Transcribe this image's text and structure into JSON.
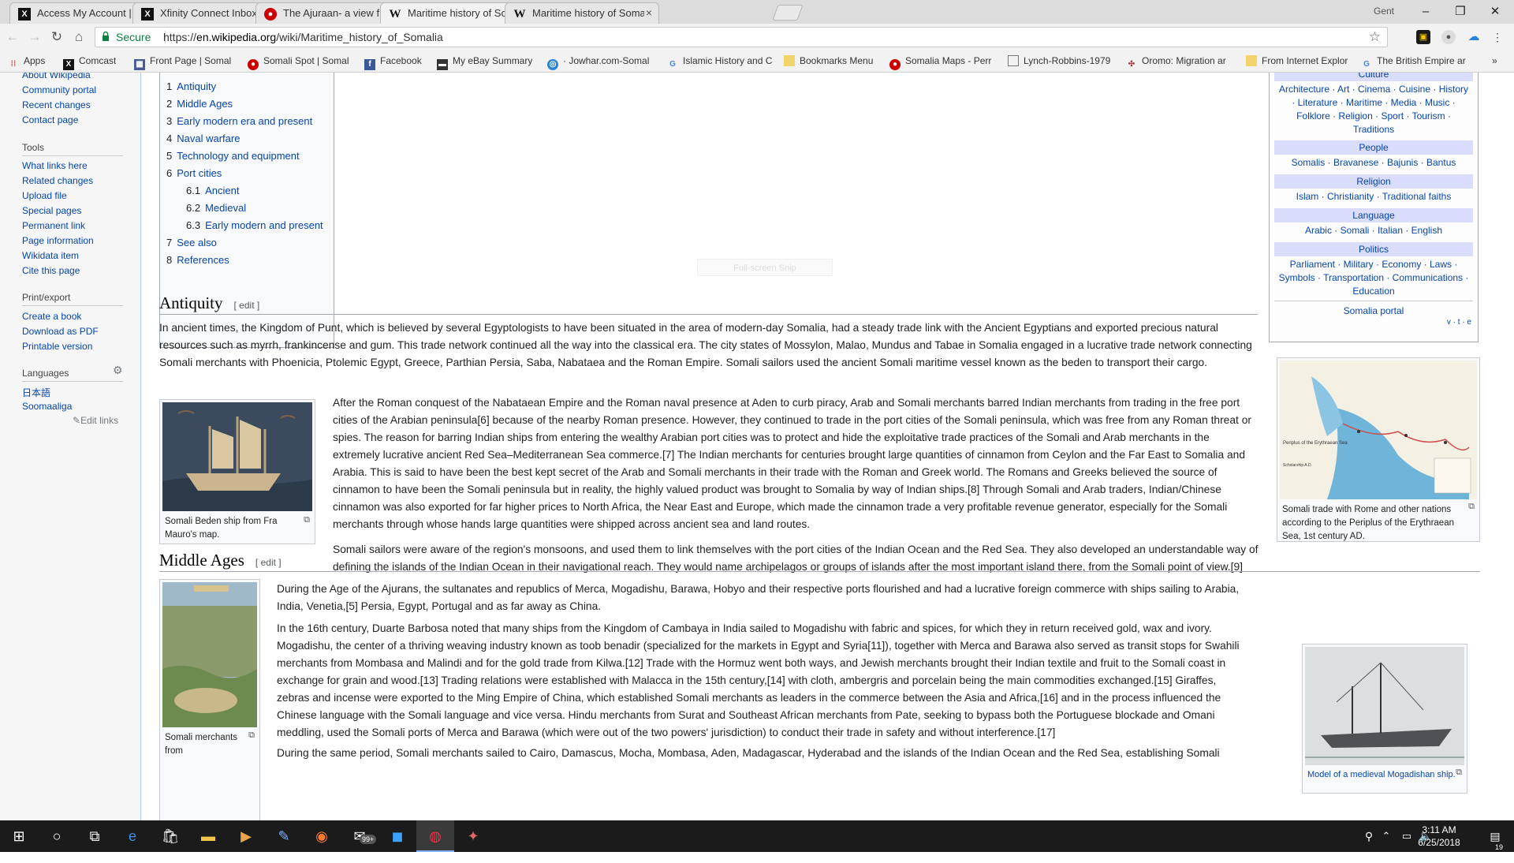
{
  "browser": {
    "tabs": [
      {
        "title": "Access My Account | Ema",
        "icon": "x-icon"
      },
      {
        "title": "Xfinity Connect Inbox",
        "icon": "x-icon"
      },
      {
        "title": "The Ajuraan- a view from",
        "icon": "pin-icon"
      },
      {
        "title": "Maritime history of Soma",
        "icon": "wikipedia-icon"
      },
      {
        "title": "Maritime history of Soma",
        "icon": "wikipedia-icon"
      }
    ],
    "user": "Gent",
    "secure_label": "Secure",
    "url_scheme": "https://",
    "url_host": "en.wikipedia.org",
    "url_path": "/wiki/Maritime_history_of_Somalia",
    "bookmarks": [
      "Apps",
      "Comcast",
      "Front Page | Somal",
      "Somali Spot | Somal",
      "Facebook",
      "My eBay Summary",
      "· Jowhar.com-Somal",
      "Islamic History and C",
      "Bookmarks Menu",
      "Somalia Maps - Perr",
      "Lynch-Robbins-1979",
      "Oromo: Migration ar",
      "From Internet Explor",
      "The British Empire ar"
    ],
    "more_bookmarks": "»"
  },
  "sidebar": {
    "top_links": [
      "About Wikipedia",
      "Community portal",
      "Recent changes",
      "Contact page"
    ],
    "tools_heading": "Tools",
    "tools": [
      "What links here",
      "Related changes",
      "Upload file",
      "Special pages",
      "Permanent link",
      "Page information",
      "Wikidata item",
      "Cite this page"
    ],
    "print_heading": "Print/export",
    "print": [
      "Create a book",
      "Download as PDF",
      "Printable version"
    ],
    "languages_heading": "Languages",
    "languages": [
      "日本語",
      "Soomaaliga"
    ],
    "edit_links": "Edit links"
  },
  "toc": [
    {
      "num": "1",
      "label": "Antiquity"
    },
    {
      "num": "2",
      "label": "Middle Ages"
    },
    {
      "num": "3",
      "label": "Early modern era and present"
    },
    {
      "num": "4",
      "label": "Naval warfare"
    },
    {
      "num": "5",
      "label": "Technology and equipment"
    },
    {
      "num": "6",
      "label": "Port cities"
    },
    {
      "num": "6.1",
      "label": "Ancient"
    },
    {
      "num": "6.2",
      "label": "Medieval"
    },
    {
      "num": "6.3",
      "label": "Early modern and present"
    },
    {
      "num": "7",
      "label": "See also"
    },
    {
      "num": "8",
      "label": "References"
    }
  ],
  "snip_hint": "Full-screen Snip",
  "antiquity": {
    "heading": "Antiquity",
    "edit": "[ edit ]",
    "p1": "In ancient times, the Kingdom of Punt, which is believed by several Egyptologists to have been situated in the area of modern-day Somalia, had a steady trade link with the Ancient Egyptians and exported precious natural resources such as myrrh, frankincense and gum. This trade network continued all the way into the classical era. The city states of Mossylon, Malao, Mundus and Tabae in Somalia engaged in a lucrative trade network connecting Somali merchants with Phoenicia, Ptolemic Egypt, Greece, Parthian Persia, Saba, Nabataea and the Roman Empire. Somali sailors used the ancient Somali maritime vessel known as the beden to transport their cargo.",
    "p2": "After the Roman conquest of the Nabataean Empire and the Roman naval presence at Aden to curb piracy, Arab and Somali merchants barred Indian merchants from trading in the free port cities of the Arabian peninsula[6] because of the nearby Roman presence. However, they continued to trade in the port cities of the Somali peninsula, which was free from any Roman threat or spies. The reason for barring Indian ships from entering the wealthy Arabian port cities was to protect and hide the exploitative trade practices of the Somali and Arab merchants in the extremely lucrative ancient Red Sea–Mediterranean Sea commerce.[7] The Indian merchants for centuries brought large quantities of cinnamon from Ceylon and the Far East to Somalia and Arabia. This is said to have been the best kept secret of the Arab and Somali merchants in their trade with the Roman and Greek world. The Romans and Greeks believed the source of cinnamon to have been the Somali peninsula but in reality, the highly valued product was brought to Somalia by way of Indian ships.[8] Through Somali and Arab traders, Indian/Chinese cinnamon was also exported for far higher prices to North Africa, the Near East and Europe, which made the cinnamon trade a very profitable revenue generator, especially for the Somali merchants through whose hands large quantities were shipped across ancient sea and land routes.",
    "p3": "Somali sailors were aware of the region's monsoons, and used them to link themselves with the port cities of the Indian Ocean and the Red Sea. They also developed an understandable way of defining the islands of the Indian Ocean in their navigational reach. They would name archipelagos or groups of islands after the most important island there, from the Somali point of view.[9]",
    "thumb_caption": "Somali Beden ship from Fra Mauro's map.",
    "map_caption": "Somali trade with Rome and other nations according to the Periplus of the Erythraean Sea, 1st century AD.",
    "map_small_title": "Periplus of the Erythraean Sea",
    "map_small_label": "Scholarship A.D."
  },
  "middle_ages": {
    "heading": "Middle Ages",
    "edit": "[ edit ]",
    "p1": "During the Age of the Ajurans, the sultanates and republics of Merca, Mogadishu, Barawa, Hobyo and their respective ports flourished and had a lucrative foreign commerce with ships sailing to Arabia, India, Venetia,[5] Persia, Egypt, Portugal and as far away as China.",
    "p2": "In the 16th century, Duarte Barbosa noted that many ships from the Kingdom of Cambaya in India sailed to Mogadishu with fabric and spices, for which they in return received gold, wax and ivory. Mogadishu, the center of a thriving weaving industry known as toob benadir (specialized for the markets in Egypt and Syria[11]), together with Merca and Barawa also served as transit stops for Swahili merchants from Mombasa and Malindi and for the gold trade from Kilwa.[12] Trade with the Hormuz went both ways, and Jewish merchants brought their Indian textile and fruit to the Somali coast in exchange for grain and wood.[13] Trading relations were established with Malacca in the 15th century,[14] with cloth, ambergris and porcelain being the main commodities exchanged.[15] Giraffes, zebras and incense were exported to the Ming Empire of China, which established Somali merchants as leaders in the commerce between the Asia and Africa,[16] and in the process influenced the Chinese language with the Somali language and vice versa. Hindu merchants from Surat and Southeast African merchants from Pate, seeking to bypass both the Portuguese blockade and Omani meddling, used the Somali ports of Merca and Barawa (which were out of the two powers' jurisdiction) to conduct their trade in safety and without interference.[17]",
    "p3": "During the same period, Somali merchants sailed to Cairo, Damascus, Mocha, Mombasa, Aden, Madagascar, Hyderabad and the islands of the Indian Ocean and the Red Sea, establishing Somali",
    "thumb_caption": "Somali merchants from",
    "model_caption": "Model of a medieval Mogadishan ship."
  },
  "navbox": {
    "culture_title": "Culture",
    "culture_lines": [
      "Architecture · Art · Cinema · Cuisine · History",
      "· Literature · Maritime · Media · Music ·",
      "Folklore · Religion · Sport · Tourism ·",
      "Traditions"
    ],
    "people_title": "People",
    "people_line": "Somalis · Bravanese · Bajunis · Bantus",
    "religion_title": "Religion",
    "religion_line": "Islam · Christianity · Traditional faiths",
    "language_title": "Language",
    "language_line": "Arabic · Somali · Italian · English",
    "politics_title": "Politics",
    "politics_lines": [
      "Parliament · Military · Economy · Laws ·",
      "Symbols · Transportation · Communications ·",
      "Education"
    ],
    "portal": "Somalia portal",
    "vte": "v · t · e"
  },
  "taskbar": {
    "time": "3:11 AM",
    "date": "6/25/2018",
    "mail_badge": "99+",
    "notif_count": "19"
  }
}
